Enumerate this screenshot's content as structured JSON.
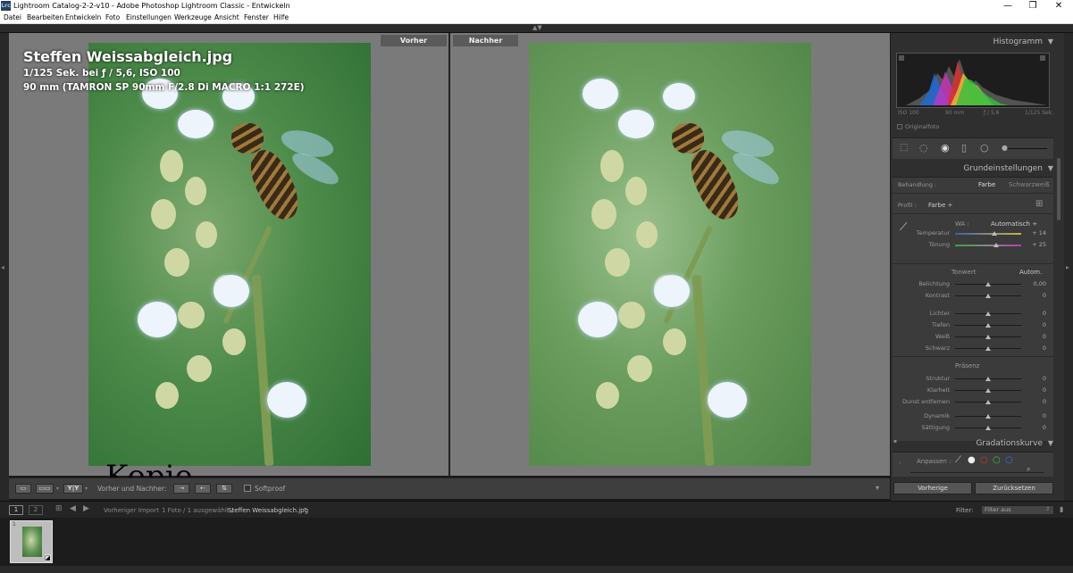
{
  "window": {
    "title": "Lightroom Catalog-2-2-v10 - Adobe Photoshop Lightroom Classic - Entwickeln",
    "app_icon": "Lrc",
    "minimize": "—",
    "maximize": "❐",
    "close": "✕"
  },
  "menu": [
    "Datei",
    "Bearbeiten",
    "Entwickeln",
    "Foto",
    "Einstellungen",
    "Werkzeuge",
    "Ansicht",
    "Fenster",
    "Hilfe"
  ],
  "view": {
    "before_label": "Vorher",
    "after_label": "Nachher",
    "filename": "Steffen Weissabgleich.jpg",
    "exposure_info": "1/125 Sek. bei ƒ / 5,6, ISO 100",
    "lens_info": "90 mm (TAMRON SP 90mm F/2.8 Di MACRO 1:1 272E)",
    "watermark": "Kopie"
  },
  "toolbar": {
    "yy_label": "Y|Y",
    "before_after_label": "Vorher und Nachher:",
    "softproof_label": "Softproof"
  },
  "right_panel": {
    "histogram": {
      "title": "Histogramm",
      "iso": "ISO 100",
      "focal": "90 mm",
      "aperture": "ƒ / 5,6",
      "shutter": "1/125 Sek.",
      "original_photo": "Originalfoto"
    },
    "basic": {
      "title": "Grundeinstellungen",
      "treatment_label": "Behandlung :",
      "color_option": "Farbe",
      "bw_option": "Schwarzweiß",
      "profile_label": "Profil :",
      "profile_value": "Farbe ÷",
      "wb_label": "WA :",
      "wb_value": "Automatisch ÷",
      "tone_label": "Tonwert",
      "auto_label": "Autom.",
      "presence_label": "Präsenz",
      "sliders": [
        {
          "label": "Temperatur",
          "value": "+ 14",
          "pos": 0.6
        },
        {
          "label": "Tönung",
          "value": "+ 25",
          "pos": 0.62
        },
        {
          "label": "Belichtung",
          "value": "0,00",
          "pos": 0.5
        },
        {
          "label": "Kontrast",
          "value": "0",
          "pos": 0.5
        },
        {
          "label": "Lichter",
          "value": "0",
          "pos": 0.5
        },
        {
          "label": "Tiefen",
          "value": "0",
          "pos": 0.5
        },
        {
          "label": "Weiß",
          "value": "0",
          "pos": 0.5
        },
        {
          "label": "Schwarz",
          "value": "0",
          "pos": 0.5
        },
        {
          "label": "Struktur",
          "value": "0",
          "pos": 0.5
        },
        {
          "label": "Klarheit",
          "value": "0",
          "pos": 0.5
        },
        {
          "label": "Dunst entfernen",
          "value": "0",
          "pos": 0.5
        },
        {
          "label": "Dynamik",
          "value": "0",
          "pos": 0.5
        },
        {
          "label": "Sättigung",
          "value": "0",
          "pos": 0.5
        }
      ]
    },
    "curve": {
      "title": "Gradationskurve",
      "adjust_label": "Anpassen :"
    },
    "previous_button": "Vorherige",
    "reset_button": "Zurücksetzen"
  },
  "filmstrip": {
    "page1": "1",
    "page2": "2",
    "source": "Vorheriger Import",
    "count": "1 Foto / 1 ausgewählt /",
    "selected_file": "Steffen Weissabgleich.jpg",
    "filter_label": "Filter:",
    "filter_value": "Filter aus",
    "thumb_index": "1"
  },
  "colors": {
    "panel_bg": "#2f2f2f",
    "view_bg": "#7a7a7a",
    "filmstrip_bg": "#1c1c1c"
  }
}
